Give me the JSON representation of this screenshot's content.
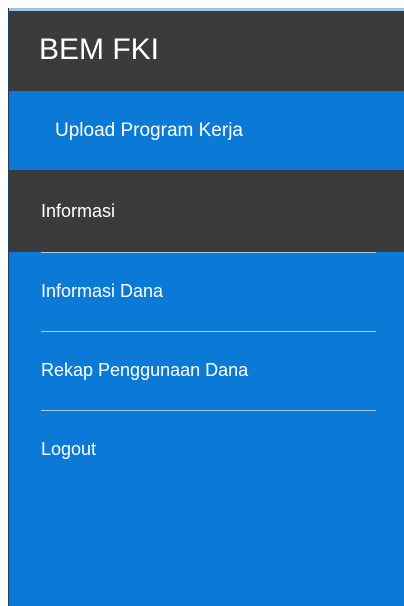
{
  "sidebar": {
    "brand": "BEM FKI",
    "items": [
      {
        "label": "Upload Program Kerja"
      },
      {
        "label": "Informasi"
      },
      {
        "label": "Informasi Dana"
      },
      {
        "label": "Rekap Penggunaan Dana"
      },
      {
        "label": "Logout"
      }
    ]
  },
  "colors": {
    "sidebar_bg": "#0a7ad6",
    "header_bg": "#3b3b3b",
    "active_item_bg": "#3b3b3b",
    "text": "#ffffff",
    "divider": "#a6cdee"
  }
}
